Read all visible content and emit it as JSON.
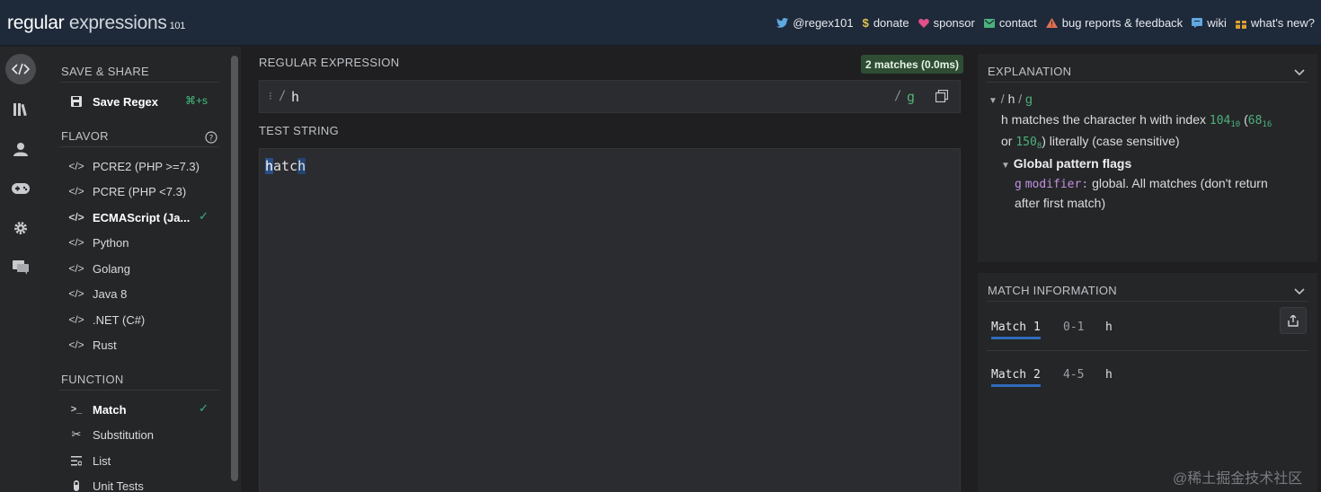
{
  "app": {
    "logo_main": "regular",
    "logo_sub": "expressions",
    "logo_num": "101"
  },
  "topnav": [
    {
      "label": "@regex101",
      "icon": "twitter-icon"
    },
    {
      "label": "donate",
      "icon": "dollar-icon"
    },
    {
      "label": "sponsor",
      "icon": "heart-icon"
    },
    {
      "label": "contact",
      "icon": "mail-icon"
    },
    {
      "label": "bug reports & feedback",
      "icon": "warning-icon"
    },
    {
      "label": "wiki",
      "icon": "book-icon"
    },
    {
      "label": "what's new?",
      "icon": "gift-icon"
    }
  ],
  "rail": [
    "code-icon",
    "library-icon",
    "user-icon",
    "gamepad-icon",
    "gear-icon",
    "chat-icon"
  ],
  "left": {
    "save_share": "SAVE & SHARE",
    "save_regex": "Save Regex",
    "save_shortcut": "⌘+s",
    "flavor": "FLAVOR",
    "flavors": [
      "PCRE2 (PHP >=7.3)",
      "PCRE (PHP <7.3)",
      "ECMAScript (Ja...",
      "Python",
      "Golang",
      "Java 8",
      ".NET (C#)",
      "Rust"
    ],
    "selected_flavor": "ECMAScript (Ja...",
    "function": "FUNCTION",
    "functions": [
      "Match",
      "Substitution",
      "List",
      "Unit Tests"
    ],
    "selected_function": "Match"
  },
  "center": {
    "regex_heading": "REGULAR EXPRESSION",
    "match_badge": "2 matches (0.0ms)",
    "regex_grip": "⁝",
    "regex_open_slash": "/",
    "regex": "h",
    "regex_close_slash": "/",
    "flags": "g",
    "test_heading": "TEST STRING",
    "test_string": "hatch"
  },
  "explanation": {
    "heading": "EXPLANATION",
    "pattern_slash1": "/",
    "pattern": "h",
    "pattern_slash2": "/",
    "pattern_flags": "g",
    "line1_a": "h matches the character h with index ",
    "idx1": "104",
    "idx1_base": "10",
    "paren_open": " (",
    "idx2": "68",
    "idx2_base": "16",
    "line2_or": "or ",
    "idx3": "150",
    "idx3_base": "8",
    "line2_rest": ") literally (case sensitive)",
    "flags_heading": "Global pattern flags",
    "flag_g": "g",
    "flag_modifier": "modifier:",
    "flag_desc1": "global. All matches (don't return",
    "flag_desc2": "after first match)"
  },
  "match_info": {
    "heading": "MATCH INFORMATION",
    "matches": [
      {
        "label": "Match 1",
        "range": "0-1",
        "value": "h"
      },
      {
        "label": "Match 2",
        "range": "4-5",
        "value": "h"
      }
    ]
  },
  "watermark": "@稀土掘金技术社区",
  "colors": {
    "topbar": "#1e2a3a",
    "accent_green": "#4cb27c",
    "match_highlight": "#2a4f86",
    "badge": "#2e4d33"
  }
}
